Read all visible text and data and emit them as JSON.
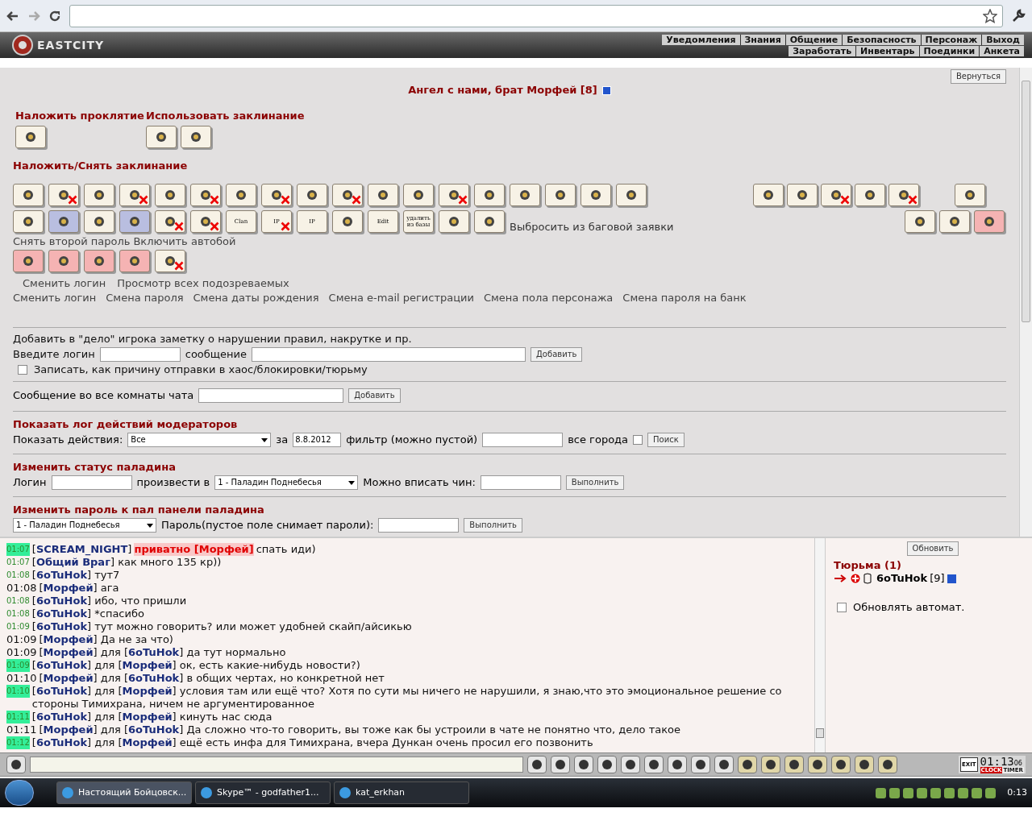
{
  "header": {
    "logo": "EASTCITY",
    "menu_top": [
      "Уведомления",
      "Знания",
      "Общение",
      "Безопасность",
      "Персонаж",
      "Выход"
    ],
    "menu_bottom": [
      "Заработать",
      "Инвентарь",
      "Поединки",
      "Анкета"
    ]
  },
  "back_button": "Вернуться",
  "title": "Ангел с нами, брат Морфей [8]",
  "curse": {
    "heading": "Наложить проклятие",
    "icons": [
      {
        "kind": "plain",
        "crossed": false
      }
    ]
  },
  "use_spell": {
    "heading": "Использовать заклинание",
    "icons": [
      {
        "kind": "plain",
        "crossed": false
      },
      {
        "kind": "plain",
        "crossed": false
      }
    ]
  },
  "spells_heading": "Наложить/Снять заклинание",
  "row1_left": [
    {
      "kind": "plain",
      "crossed": false
    },
    {
      "kind": "plain",
      "crossed": true
    },
    {
      "kind": "plain",
      "crossed": false
    },
    {
      "kind": "plain",
      "crossed": true
    },
    {
      "kind": "plain",
      "crossed": false
    },
    {
      "kind": "plain",
      "crossed": true
    },
    {
      "kind": "plain",
      "crossed": false
    },
    {
      "kind": "plain",
      "crossed": true
    },
    {
      "kind": "plain",
      "crossed": false
    },
    {
      "kind": "plain",
      "crossed": true
    },
    {
      "kind": "plain",
      "crossed": false
    },
    {
      "kind": "plain",
      "crossed": false
    },
    {
      "kind": "plain",
      "crossed": true
    },
    {
      "kind": "plain",
      "crossed": false
    },
    {
      "kind": "plain",
      "crossed": false
    },
    {
      "kind": "plain",
      "crossed": false
    },
    {
      "kind": "plain",
      "crossed": false
    },
    {
      "kind": "plain",
      "crossed": false
    }
  ],
  "row1_right": [
    {
      "kind": "plain",
      "crossed": false
    },
    {
      "kind": "plain",
      "crossed": false
    },
    {
      "kind": "plain",
      "crossed": true
    },
    {
      "kind": "plain",
      "crossed": false
    },
    {
      "kind": "plain",
      "crossed": true
    }
  ],
  "row1_far": [
    {
      "kind": "plain",
      "crossed": false
    }
  ],
  "row2_left": [
    {
      "kind": "plain",
      "crossed": false
    },
    {
      "kind": "blue",
      "crossed": false
    },
    {
      "kind": "plain",
      "crossed": false
    },
    {
      "kind": "blue",
      "crossed": false
    },
    {
      "kind": "plain",
      "crossed": true
    },
    {
      "kind": "plain",
      "crossed": true
    },
    {
      "kind": "plain",
      "crossed": false,
      "label": "Clan"
    },
    {
      "kind": "plain",
      "crossed": true,
      "label": "IP"
    },
    {
      "kind": "plain",
      "crossed": false,
      "label": "IP"
    },
    {
      "kind": "plain",
      "crossed": false
    },
    {
      "kind": "plain",
      "crossed": false,
      "label": "Edit"
    },
    {
      "kind": "plain",
      "crossed": false,
      "label": "удалить из базы"
    },
    {
      "kind": "plain",
      "crossed": false
    },
    {
      "kind": "plain",
      "crossed": false
    }
  ],
  "row2_link": "Выбросить из баговой заявки",
  "row2_right": [
    {
      "kind": "plain",
      "crossed": false
    },
    {
      "kind": "plain",
      "crossed": false
    },
    {
      "kind": "pink",
      "crossed": false
    }
  ],
  "row2_texts": [
    "Снять второй пароль",
    "Включить автобой"
  ],
  "row3": [
    {
      "kind": "pink",
      "crossed": false
    },
    {
      "kind": "pink",
      "crossed": false
    },
    {
      "kind": "pink",
      "crossed": false
    },
    {
      "kind": "pink",
      "crossed": false
    },
    {
      "kind": "plain",
      "crossed": true
    }
  ],
  "links_a": [
    "Сменить логин",
    "Просмотр всех подозреваемых"
  ],
  "links_b": [
    "Сменить логин",
    "Смена пароля",
    "Смена даты рождения",
    "Смена e-mail регистрации",
    "Смена пола персонажа",
    "Смена пароля на банк"
  ],
  "note_form": {
    "intro": "Добавить в \"дело\" игрока заметку о нарушении правил, накрутке и пр.",
    "login_label": "Введите логин",
    "message_label": "сообщение",
    "button": "Добавить",
    "checkbox": {
      "label": "Записать, как причину отправки в хаос/блокировки/тюрьму",
      "checked": false
    }
  },
  "broadcast_form": {
    "label": "Сообщение во все комнаты чата",
    "button": "Добавить"
  },
  "log_form": {
    "heading": "Показать лог действий модераторов",
    "actions_label": "Показать действия:",
    "actions_value": "Все",
    "date_label": "за",
    "date_value": "8.8.2012",
    "filter_label": "фильтр (можно пустой)",
    "all_cities": {
      "label": "все города",
      "checked": false
    },
    "button": "Поиск"
  },
  "status_form": {
    "heading": "Изменить статус паладина",
    "login_label": "Логин",
    "promote_label": "произвести в",
    "promote_value": "1 - Паладин Поднебесья",
    "rank_label": "Можно вписать чин:",
    "button": "Выполнить"
  },
  "password_form": {
    "heading": "Изменить пароль к пал панели паладина",
    "select_value": "1 - Паладин Поднебесья",
    "password_label": "Пароль(пустое поле снимает пароли):",
    "button": "Выполнить"
  },
  "chat": [
    {
      "time": "01:07",
      "kind": "highlight",
      "sender": "[**SCREAM_NIGHT**]",
      "private": "приватно [Морфей]",
      "text": "спать иди)"
    },
    {
      "time": "01:07",
      "kind": "small",
      "text": "[**Общий Враг**] как много 135 кр))"
    },
    {
      "time": "01:08",
      "kind": "small",
      "text": "[**6oTuHok**] тут7"
    },
    {
      "time": "01:08",
      "kind": "plain",
      "text": "[**Морфей**] ага"
    },
    {
      "time": "01:08",
      "kind": "small",
      "text": "[**6oTuHok**] ибо, что пришли"
    },
    {
      "time": "01:08",
      "kind": "small",
      "text": "[**6oTuHok**] *спасибо"
    },
    {
      "time": "01:09",
      "kind": "small",
      "text": "[**6oTuHok**] тут можно говорить? или может удобней скайп/айсикью"
    },
    {
      "time": "01:09",
      "kind": "plain",
      "text": "[**Морфей**] Да не за что)"
    },
    {
      "time": "01:09",
      "kind": "plain",
      "text": "[**Морфей**] для [**6oTuHok**] да тут нормально"
    },
    {
      "time": "01:09",
      "kind": "highlight",
      "text": "[**6oTuHok**] для [**Морфей**] ок, есть какие-нибудь новости?)"
    },
    {
      "time": "01:10",
      "kind": "plain",
      "text": "[**Морфей**] для [**6oTuHok**] в общих чертах, но конкретной нет"
    },
    {
      "time": "01:10",
      "kind": "highlight",
      "text": "[**6oTuHok**] для [**Морфей**] условия там или ещё что? Хотя по сути мы ничего не нарушили, я знаю,что это эмоциональное решение со стороны Тимихрана, ничем не аргументированное"
    },
    {
      "time": "01:11",
      "kind": "highlight",
      "text": "[**6oTuHok**] для [**Морфей**] кинуть нас сюда"
    },
    {
      "time": "01:11",
      "kind": "plain",
      "text": "[**Морфей**] для [**6oTuHok**] Да сложно что-то говорить, вы тоже как бы устроили в чате не понятно что, дело такое"
    },
    {
      "time": "01:12",
      "kind": "highlight",
      "text": "[**6oTuHok**] для [**Морфей**] ещё есть инфа для Тимихрана, вчера Дункан очень просил его позвонить"
    }
  ],
  "online": {
    "refresh": "Обновить",
    "room": "Тюрьма (1)",
    "user": "6oTuHok",
    "level": "[9]",
    "auto": {
      "label": "Обновлять автомат.",
      "checked": false
    }
  },
  "clock": {
    "exit": "EXIT",
    "time": "01:13",
    "seconds": "06",
    "clock_label": "CLOCK",
    "timer_label": "TIMER"
  },
  "taskbar": {
    "tasks": [
      {
        "label": "Настоящий Бойцовск...",
        "selected": true
      },
      {
        "label": "Skype™ - godfather1...",
        "selected": false
      },
      {
        "label": "kat_erkhan",
        "selected": false
      }
    ],
    "time": "0:13"
  }
}
